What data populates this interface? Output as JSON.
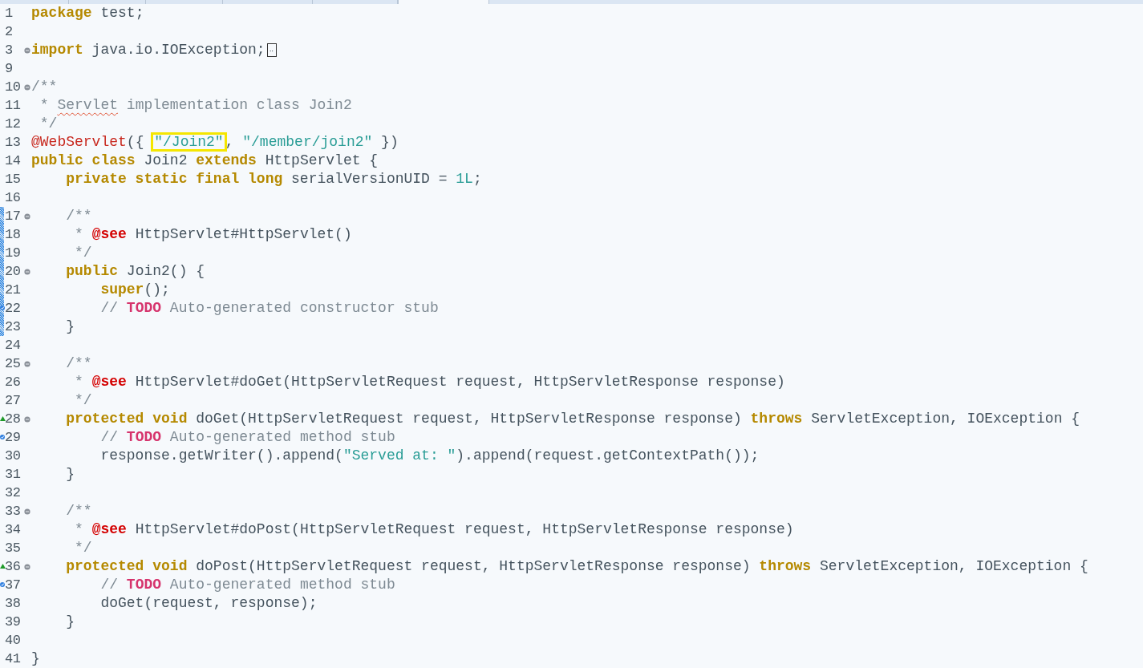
{
  "tabs": [
    {
      "selected": false
    },
    {
      "selected": false
    },
    {
      "selected": false
    },
    {
      "selected": false
    },
    {
      "selected": false
    },
    {
      "selected": true
    }
  ],
  "lines": [
    {
      "number": "1",
      "fold": false,
      "changed": false,
      "tokens": [
        {
          "kind": "kw",
          "text": "package"
        },
        {
          "kind": "plain",
          "text": " test;"
        }
      ]
    },
    {
      "number": "2",
      "fold": false,
      "changed": false
    },
    {
      "number": "3",
      "fold": true,
      "changed": false,
      "tokens": [
        {
          "kind": "kw",
          "text": "import"
        },
        {
          "kind": "plain",
          "text": " java.io.IOException;"
        },
        {
          "kind": "foldbox",
          "text": "‥"
        }
      ]
    },
    {
      "number": "9",
      "fold": false,
      "changed": false
    },
    {
      "number": "10",
      "fold": true,
      "changed": false,
      "tokens": [
        {
          "kind": "cmt",
          "text": "/**"
        }
      ]
    },
    {
      "number": "11",
      "fold": false,
      "changed": false,
      "tokens": [
        {
          "kind": "cmt",
          "text": " * "
        },
        {
          "kind": "spell",
          "text": "Servlet"
        },
        {
          "kind": "cmt",
          "text": " implementation class Join2"
        }
      ]
    },
    {
      "number": "12",
      "fold": false,
      "changed": false,
      "tokens": [
        {
          "kind": "cmt",
          "text": " */"
        }
      ]
    },
    {
      "number": "13",
      "fold": false,
      "changed": false,
      "tokens": [
        {
          "kind": "ann",
          "text": "@WebServlet"
        },
        {
          "kind": "plain",
          "text": "({ "
        },
        {
          "kind": "boxstr",
          "text": "\"/Join2\""
        },
        {
          "kind": "plain",
          "text": ", "
        },
        {
          "kind": "str",
          "text": "\"/member/join2\""
        },
        {
          "kind": "plain",
          "text": " })"
        }
      ]
    },
    {
      "number": "14",
      "fold": false,
      "changed": false,
      "tokens": [
        {
          "kind": "kw",
          "text": "public class"
        },
        {
          "kind": "plain",
          "text": " Join2 "
        },
        {
          "kind": "kw",
          "text": "extends"
        },
        {
          "kind": "plain",
          "text": " HttpServlet {"
        }
      ]
    },
    {
      "number": "15",
      "fold": false,
      "changed": false,
      "tokens": [
        {
          "kind": "kw",
          "text": "    private static final long"
        },
        {
          "kind": "plain",
          "text": " serialVersionUID = "
        },
        {
          "kind": "num",
          "text": "1L"
        },
        {
          "kind": "plain",
          "text": ";"
        }
      ]
    },
    {
      "number": "16",
      "fold": false,
      "changed": false
    },
    {
      "number": "17",
      "fold": true,
      "changed": true,
      "tokens": [
        {
          "kind": "cmt",
          "text": "    /**"
        }
      ]
    },
    {
      "number": "18",
      "fold": false,
      "changed": true,
      "tokens": [
        {
          "kind": "cmt",
          "text": "     * "
        },
        {
          "kind": "tag",
          "text": "@see"
        },
        {
          "kind": "doc",
          "text": " HttpServlet#HttpServlet()"
        }
      ]
    },
    {
      "number": "19",
      "fold": false,
      "changed": true,
      "tokens": [
        {
          "kind": "cmt",
          "text": "     */"
        }
      ]
    },
    {
      "number": "20",
      "fold": true,
      "changed": true,
      "tokens": [
        {
          "kind": "kw",
          "text": "    public"
        },
        {
          "kind": "plain",
          "text": " Join2() {"
        }
      ]
    },
    {
      "number": "21",
      "fold": false,
      "changed": true,
      "tokens": [
        {
          "kind": "kw",
          "text": "        super"
        },
        {
          "kind": "plain",
          "text": "();"
        }
      ]
    },
    {
      "number": "22",
      "fold": false,
      "changed": true,
      "marker": {
        "kind": "task"
      },
      "tokens": [
        {
          "kind": "cmt",
          "text": "        // "
        },
        {
          "kind": "todo",
          "text": "TODO"
        },
        {
          "kind": "cmt",
          "text": " Auto-generated constructor stub"
        }
      ]
    },
    {
      "number": "23",
      "fold": false,
      "changed": true,
      "tokens": [
        {
          "kind": "plain",
          "text": "    }"
        }
      ]
    },
    {
      "number": "24",
      "fold": false,
      "changed": false
    },
    {
      "number": "25",
      "fold": true,
      "changed": false,
      "tokens": [
        {
          "kind": "cmt",
          "text": "    /**"
        }
      ]
    },
    {
      "number": "26",
      "fold": false,
      "changed": false,
      "tokens": [
        {
          "kind": "cmt",
          "text": "     * "
        },
        {
          "kind": "tag",
          "text": "@see"
        },
        {
          "kind": "doc",
          "text": " HttpServlet#doGet(HttpServletRequest request, HttpServletResponse response)"
        }
      ]
    },
    {
      "number": "27",
      "fold": false,
      "changed": false,
      "tokens": [
        {
          "kind": "cmt",
          "text": "     */"
        }
      ]
    },
    {
      "number": "28",
      "fold": true,
      "changed": false,
      "marker": {
        "kind": "override"
      },
      "tokens": [
        {
          "kind": "kw",
          "text": "    protected void"
        },
        {
          "kind": "plain",
          "text": " doGet(HttpServletRequest request, HttpServletResponse response) "
        },
        {
          "kind": "kw",
          "text": "throws"
        },
        {
          "kind": "plain",
          "text": " ServletException, IOException {"
        }
      ]
    },
    {
      "number": "29",
      "fold": false,
      "changed": false,
      "marker": {
        "kind": "task"
      },
      "tokens": [
        {
          "kind": "cmt",
          "text": "        // "
        },
        {
          "kind": "todo",
          "text": "TODO"
        },
        {
          "kind": "cmt",
          "text": " Auto-generated method stub"
        }
      ]
    },
    {
      "number": "30",
      "fold": false,
      "changed": false,
      "tokens": [
        {
          "kind": "plain",
          "text": "        response.getWriter().append("
        },
        {
          "kind": "str",
          "text": "\"Served at: \""
        },
        {
          "kind": "plain",
          "text": ").append(request.getContextPath());"
        }
      ]
    },
    {
      "number": "31",
      "fold": false,
      "changed": false,
      "tokens": [
        {
          "kind": "plain",
          "text": "    }"
        }
      ]
    },
    {
      "number": "32",
      "fold": false,
      "changed": false
    },
    {
      "number": "33",
      "fold": true,
      "changed": false,
      "tokens": [
        {
          "kind": "cmt",
          "text": "    /**"
        }
      ]
    },
    {
      "number": "34",
      "fold": false,
      "changed": false,
      "tokens": [
        {
          "kind": "cmt",
          "text": "     * "
        },
        {
          "kind": "tag",
          "text": "@see"
        },
        {
          "kind": "doc",
          "text": " HttpServlet#doPost(HttpServletRequest request, HttpServletResponse response)"
        }
      ]
    },
    {
      "number": "35",
      "fold": false,
      "changed": false,
      "tokens": [
        {
          "kind": "cmt",
          "text": "     */"
        }
      ]
    },
    {
      "number": "36",
      "fold": true,
      "changed": false,
      "marker": {
        "kind": "override"
      },
      "tokens": [
        {
          "kind": "kw",
          "text": "    protected void"
        },
        {
          "kind": "plain",
          "text": " doPost(HttpServletRequest request, HttpServletResponse response) "
        },
        {
          "kind": "kw",
          "text": "throws"
        },
        {
          "kind": "plain",
          "text": " ServletException, IOException {"
        }
      ]
    },
    {
      "number": "37",
      "fold": false,
      "changed": false,
      "marker": {
        "kind": "task"
      },
      "tokens": [
        {
          "kind": "cmt",
          "text": "        // "
        },
        {
          "kind": "todo",
          "text": "TODO"
        },
        {
          "kind": "cmt",
          "text": " Auto-generated method stub"
        }
      ]
    },
    {
      "number": "38",
      "fold": false,
      "changed": false,
      "tokens": [
        {
          "kind": "plain",
          "text": "        doGet(request, response);"
        }
      ]
    },
    {
      "number": "39",
      "fold": false,
      "changed": false,
      "tokens": [
        {
          "kind": "plain",
          "text": "    }"
        }
      ]
    },
    {
      "number": "40",
      "fold": false,
      "changed": false
    },
    {
      "number": "41",
      "fold": false,
      "changed": false,
      "tokens": [
        {
          "kind": "plain",
          "text": "}"
        }
      ]
    }
  ]
}
